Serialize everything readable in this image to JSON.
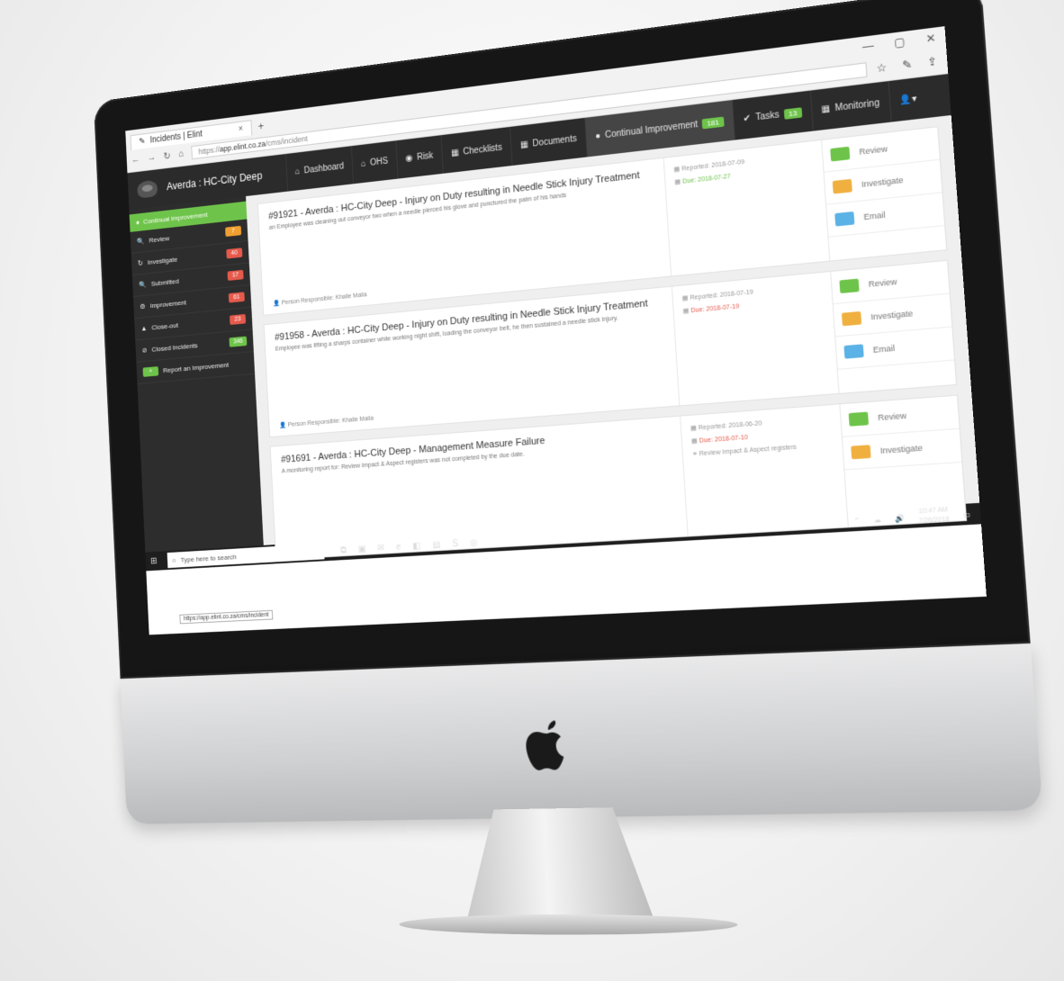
{
  "browser": {
    "tab_title": "Incidents | Elint",
    "tab_close": "×",
    "tab_new": "+",
    "url_prefix": "https://",
    "url_domain": "app.elint.co.za",
    "url_path": "/cms/incident",
    "window_controls": [
      "—",
      "▢",
      "✕"
    ],
    "toolbar_icons": [
      "☆",
      "✎",
      "⇪"
    ]
  },
  "header": {
    "site_title": "Averda : HC-City Deep",
    "nav": [
      {
        "label": "Dashboard",
        "icon": "home-icon",
        "glyph": "⌂"
      },
      {
        "label": "OHS",
        "icon": "home-icon",
        "glyph": "⌂"
      },
      {
        "label": "Risk",
        "icon": "eye-icon",
        "glyph": "◉"
      },
      {
        "label": "Checklists",
        "icon": "list-icon",
        "glyph": "▦"
      },
      {
        "label": "Documents",
        "icon": "list-icon",
        "glyph": "▦"
      },
      {
        "label": "Continual Improvement",
        "icon": "ci-icon",
        "glyph": "●",
        "badge": "181"
      },
      {
        "label": "Tasks",
        "icon": "check-icon",
        "glyph": "✔",
        "badge": "13"
      },
      {
        "label": "Monitoring",
        "icon": "list-icon",
        "glyph": "▦"
      }
    ],
    "user_glyph": "👤▾"
  },
  "sidebar": {
    "head": "Continual Improvement",
    "items": [
      {
        "label": "Review",
        "count": "7",
        "color": "#f0a030",
        "glyph": "🔍"
      },
      {
        "label": "Investigate",
        "count": "40",
        "color": "#e65a4c",
        "glyph": "↻"
      },
      {
        "label": "Submitted",
        "count": "17",
        "color": "#e65a4c",
        "glyph": "🔍"
      },
      {
        "label": "Improvement",
        "count": "61",
        "color": "#e65a4c",
        "glyph": "⚙"
      },
      {
        "label": "Close-out",
        "count": "23",
        "color": "#e65a4c",
        "glyph": "▲"
      },
      {
        "label": "Closed Incidents",
        "count": "346",
        "color": "#6ec44a",
        "glyph": "⊘"
      },
      {
        "label": "Report an Improvement",
        "count": "",
        "color": "",
        "glyph": "+"
      }
    ],
    "status_url": "https://app.elint.co.za/cms/incident"
  },
  "cards": [
    {
      "title": "#91921 - Averda : HC-City Deep - Injury on Duty resulting in Needle Stick Injury Treatment",
      "desc": "an Employee was cleaning out conveyor two when a needle pierced his glove and punctured the palm of his hands",
      "responsible": "Person Responsible: Khalie Maila",
      "reported": "Reported: 2018-07-09",
      "due": "Due: 2018-07-27",
      "due_status": "green",
      "extra": ""
    },
    {
      "title": "#91958 - Averda : HC-City Deep - Injury on Duty resulting in Needle Stick Injury Treatment",
      "desc": "Employee was lifting a sharps container while working night shift, loading the conveyor belt, he then sustained a needle stick injury.",
      "responsible": "Person Responsible: Khalie Maila",
      "reported": "Reported: 2018-07-19",
      "due": "Due: 2018-07-19",
      "due_status": "red",
      "extra": ""
    },
    {
      "title": "#91691 - Averda : HC-City Deep - Management Measure Failure",
      "desc": "A monitoring report for: Review Impact & Aspect registers was not completed by the due date.",
      "responsible": "",
      "reported": "Reported: 2018-06-20",
      "due": "Due: 2018-07-10",
      "due_status": "red",
      "extra": "Review Impact & Aspect registers"
    }
  ],
  "actions": {
    "review": "Review",
    "investigate": "Investigate",
    "email": "Email"
  },
  "taskbar": {
    "search_placeholder": "Type here to search",
    "time": "10:47 AM",
    "date": "7/26/2018"
  },
  "colors": {
    "accent": "#6ec44a",
    "header_bg": "#2b2b2b",
    "due_red": "#e65a4c"
  }
}
